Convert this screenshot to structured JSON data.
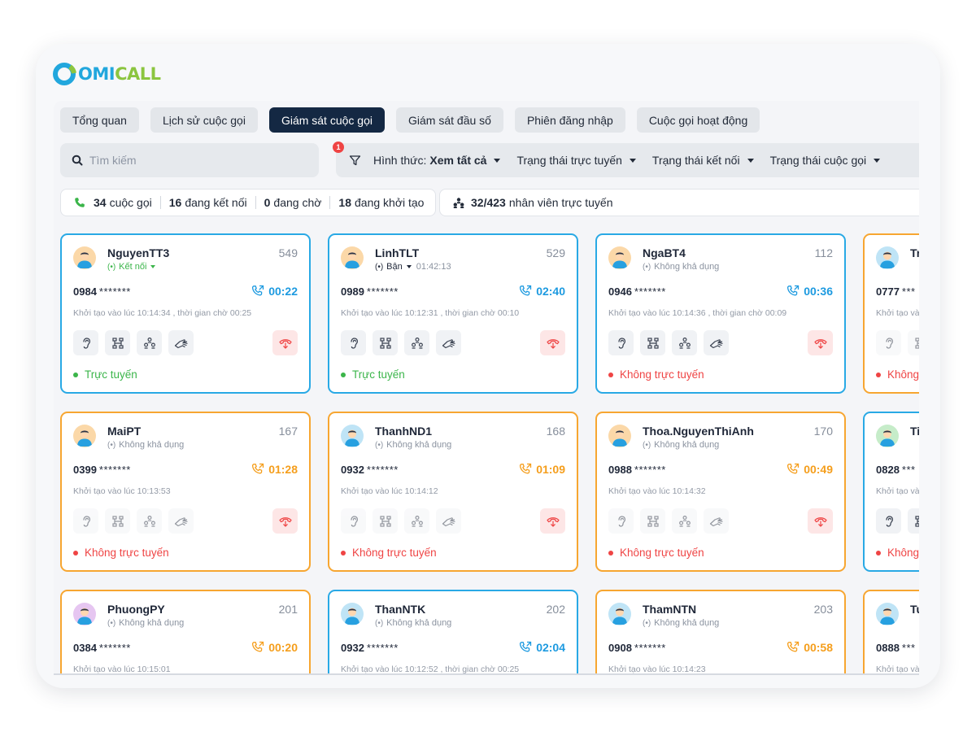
{
  "logo": {
    "part1": "OMI",
    "part2": "CALL"
  },
  "tabs": [
    {
      "label": "Tổng quan",
      "active": false
    },
    {
      "label": "Lịch sử cuộc gọi",
      "active": false
    },
    {
      "label": "Giám sát cuộc gọi",
      "active": true
    },
    {
      "label": "Giám sát đầu số",
      "active": false
    },
    {
      "label": "Phiên đăng nhập",
      "active": false
    },
    {
      "label": "Cuộc gọi hoạt động",
      "active": false
    }
  ],
  "search": {
    "placeholder": "Tìm kiếm"
  },
  "filters": {
    "badge": "1",
    "form_label": "Hình thức:",
    "form_value": "Xem tất cả",
    "online_status": "Trạng thái trực tuyến",
    "connection_status": "Trạng thái kết nối",
    "call_status": "Trạng thái cuộc gọi"
  },
  "stats": {
    "calls_num": "34",
    "calls_label": "cuộc gọi",
    "connecting_num": "16",
    "connecting_label": "đang kết nối",
    "waiting_num": "0",
    "waiting_label": "đang chờ",
    "init_num": "18",
    "init_label": "đang khởi tạo",
    "online_num": "32/423",
    "online_label": "nhân viên trực tuyến"
  },
  "colors": {
    "blue": "#29a9e5",
    "orange": "#f7a631",
    "green": "#3bb54a",
    "red": "#ef4444",
    "navy": "#142843"
  },
  "cards": [
    {
      "name": "NguyenTT3",
      "ext": "549",
      "status": "Kết nối",
      "status_type": "ok",
      "status_time": "",
      "phone": "0984",
      "mask": "*******",
      "duration": "00:22",
      "init": "Khởi tạo vào lúc 10:14:34 , thời gian chờ 00:25",
      "conn": "Trực tuyến",
      "conn_type": "on",
      "color": "blue",
      "avatar": "orange",
      "actions_enabled": true
    },
    {
      "name": "LinhTLT",
      "ext": "529",
      "status": "Bận",
      "status_type": "busy",
      "status_time": "01:42:13",
      "phone": "0989",
      "mask": "*******",
      "duration": "02:40",
      "init": "Khởi tạo vào lúc 10:12:31 , thời gian chờ 00:10",
      "conn": "Trực tuyến",
      "conn_type": "on",
      "color": "blue",
      "avatar": "orange",
      "actions_enabled": true
    },
    {
      "name": "NgaBT4",
      "ext": "112",
      "status": "Không khả dụng",
      "status_type": "na",
      "status_time": "",
      "phone": "0946",
      "mask": "*******",
      "duration": "00:36",
      "init": "Khởi tạo vào lúc 10:14:36 , thời gian chờ 00:09",
      "conn": "Không trực tuyến",
      "conn_type": "off",
      "color": "blue",
      "avatar": "orange",
      "actions_enabled": true
    },
    {
      "name": "Tr",
      "ext": "",
      "status": "",
      "status_type": "na",
      "status_time": "",
      "phone": "0777",
      "mask": "***",
      "duration": "",
      "init": "Khởi tạo vào",
      "conn": "Không",
      "conn_type": "off",
      "color": "orange",
      "avatar": "blue",
      "actions_enabled": false
    },
    {
      "name": "MaiPT",
      "ext": "167",
      "status": "Không khả dụng",
      "status_type": "na",
      "status_time": "",
      "phone": "0399",
      "mask": "*******",
      "duration": "01:28",
      "init": "Khởi tạo vào lúc 10:13:53",
      "conn": "Không trực tuyến",
      "conn_type": "off",
      "color": "orange",
      "avatar": "orange",
      "actions_enabled": false
    },
    {
      "name": "ThanhND1",
      "ext": "168",
      "status": "Không khả dụng",
      "status_type": "na",
      "status_time": "",
      "phone": "0932",
      "mask": "*******",
      "duration": "01:09",
      "init": "Khởi tạo vào lúc 10:14:12",
      "conn": "Không trực tuyến",
      "conn_type": "off",
      "color": "orange",
      "avatar": "blue",
      "actions_enabled": false
    },
    {
      "name": "Thoa.NguyenThiAnh",
      "ext": "170",
      "status": "Không khả dụng",
      "status_type": "na",
      "status_time": "",
      "phone": "0988",
      "mask": "*******",
      "duration": "00:49",
      "init": "Khởi tạo vào lúc 10:14:32",
      "conn": "Không trực tuyến",
      "conn_type": "off",
      "color": "orange",
      "avatar": "orange",
      "actions_enabled": false
    },
    {
      "name": "Ti",
      "ext": "",
      "status": "",
      "status_type": "na",
      "status_time": "",
      "phone": "0828",
      "mask": "***",
      "duration": "",
      "init": "Khởi tạo vào",
      "conn": "Không",
      "conn_type": "off",
      "color": "blue",
      "avatar": "green",
      "actions_enabled": true
    },
    {
      "name": "PhuongPY",
      "ext": "201",
      "status": "Không khả dụng",
      "status_type": "na",
      "status_time": "",
      "phone": "0384",
      "mask": "*******",
      "duration": "00:20",
      "init": "Khởi tạo vào lúc 10:15:01",
      "conn": "",
      "conn_type": "off",
      "color": "orange",
      "avatar": "purple",
      "actions_enabled": false
    },
    {
      "name": "ThanNTK",
      "ext": "202",
      "status": "Không khả dụng",
      "status_type": "na",
      "status_time": "",
      "phone": "0932",
      "mask": "*******",
      "duration": "02:04",
      "init": "Khởi tạo vào lúc 10:12:52 , thời gian chờ 00:25",
      "conn": "",
      "conn_type": "off",
      "color": "blue",
      "avatar": "blue",
      "actions_enabled": false
    },
    {
      "name": "ThamNTN",
      "ext": "203",
      "status": "Không khả dụng",
      "status_type": "na",
      "status_time": "",
      "phone": "0908",
      "mask": "*******",
      "duration": "00:58",
      "init": "Khởi tạo vào lúc 10:14:23",
      "conn": "",
      "conn_type": "off",
      "color": "orange",
      "avatar": "blue",
      "actions_enabled": false
    },
    {
      "name": "Tu",
      "ext": "",
      "status": "",
      "status_type": "na",
      "status_time": "",
      "phone": "0888",
      "mask": "***",
      "duration": "",
      "init": "Khởi tạo vào",
      "conn": "",
      "conn_type": "off",
      "color": "orange",
      "avatar": "blue",
      "actions_enabled": false
    }
  ]
}
